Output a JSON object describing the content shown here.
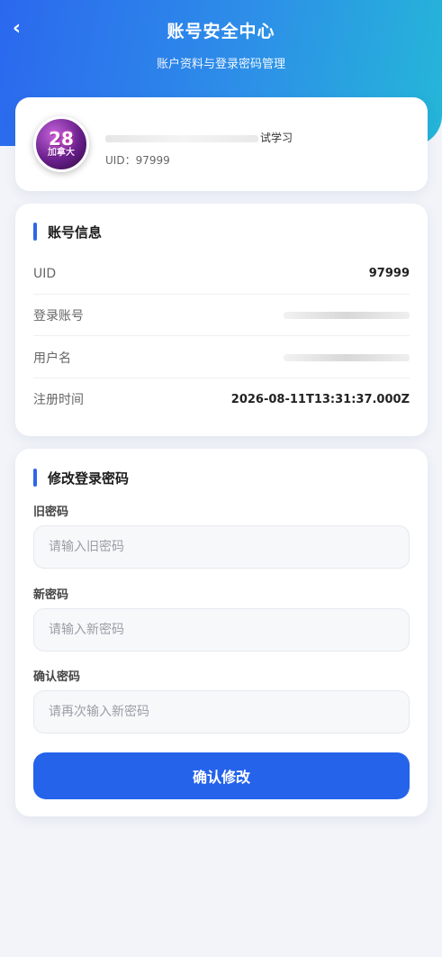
{
  "header": {
    "back_icon": "‹",
    "title": "账号安全中心",
    "subtitle": "账户资料与登录密码管理"
  },
  "profile": {
    "avatar_num": "28",
    "avatar_text": "加拿大",
    "nickname_visible": "试学习",
    "uid_text": "UID：97999"
  },
  "account_info": {
    "title": "账号信息",
    "rows": [
      {
        "label": "UID",
        "value": "97999"
      },
      {
        "label": "登录账号",
        "value": ""
      },
      {
        "label": "用户名",
        "value": ""
      },
      {
        "label": "注册时间",
        "value": "2026-08-11T13:31:37.000Z"
      }
    ]
  },
  "password": {
    "title": "修改登录密码",
    "old_label": "旧密码",
    "old_placeholder": "请输入旧密码",
    "new_label": "新密码",
    "new_placeholder": "请输入新密码",
    "confirm_label": "确认密码",
    "confirm_placeholder": "请再次输入新密码",
    "submit_label": "确认修改"
  },
  "colors": {
    "accent": "#2563eb",
    "header_start": "#2b68ee",
    "header_end": "#25b6d8"
  }
}
